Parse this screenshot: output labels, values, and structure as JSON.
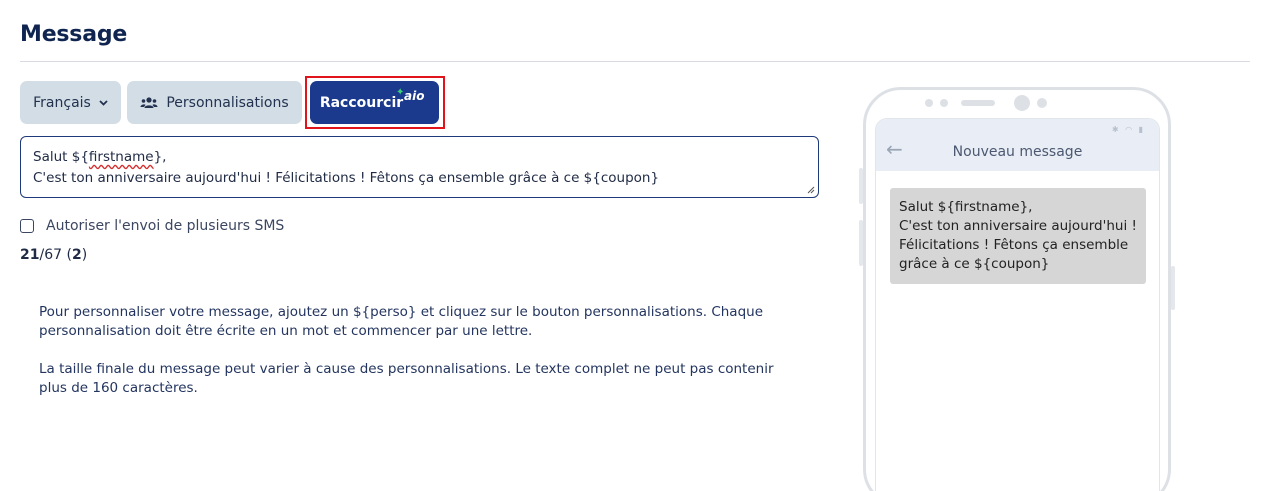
{
  "section": {
    "title": "Message"
  },
  "toolbar": {
    "language_label": "Français",
    "personalisations_label": "Personnalisations",
    "shorten_label": "Raccourcir",
    "shorten_badge": "aio"
  },
  "editor": {
    "line1_prefix": "Salut ${",
    "line1_word": "firstname",
    "line1_suffix": "},",
    "line2": "C'est ton anniversaire aujourd'hui ! Félicitations ! Fêtons ça ensemble grâce à ce ${coupon}"
  },
  "options": {
    "multi_sms_label": "Autoriser l'envoi de plusieurs SMS",
    "multi_sms_checked": false
  },
  "counter": {
    "used": "21",
    "separator": "/67 (",
    "segments": "2",
    "close": ")"
  },
  "help": {
    "paragraph1": "Pour personnaliser votre message, ajoutez un ${perso} et cliquez sur le bouton personnalisations. Chaque personnalisation doit être écrite en un mot et commencer par une lettre.",
    "paragraph2": "La taille finale du message peut varier à cause des personnalisations. Le texte complet ne peut pas contenir plus de 160 caractères."
  },
  "preview": {
    "header_title": "Nouveau message",
    "status_icons": "✱ ◠ ▮",
    "bubble_text": "Salut ${firstname},\nC'est ton anniversaire aujourd'hui ! Félicitations ! Fêtons ça ensemble grâce à ce ${coupon}"
  },
  "colors": {
    "accent": "#1b3a8e",
    "highlight": "#e0141a",
    "button_gray": "#d3dde6"
  }
}
